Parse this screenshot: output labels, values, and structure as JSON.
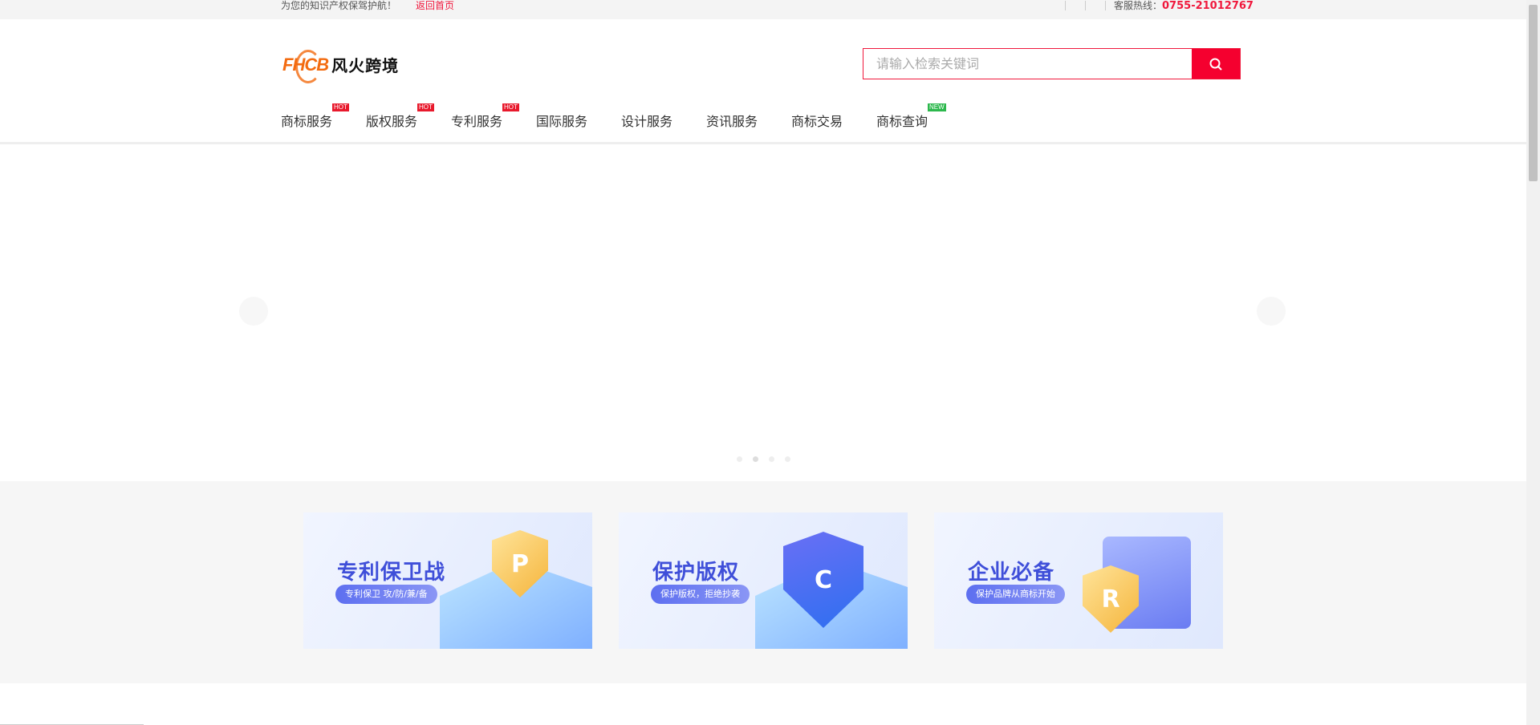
{
  "topbar": {
    "slogan": "为您的知识产权保驾护航！",
    "home_link": "返回首页",
    "hotline_label": "客服热线：",
    "hotline": "0755-21012767"
  },
  "header": {
    "logo_mark": "FHCB",
    "logo_text": "风火跨境",
    "search_placeholder": "请输入检索关键词"
  },
  "nav": [
    {
      "label": "商标服务",
      "badge": "HOT"
    },
    {
      "label": "版权服务",
      "badge": "HOT"
    },
    {
      "label": "专利服务",
      "badge": "HOT"
    },
    {
      "label": "国际服务"
    },
    {
      "label": "设计服务"
    },
    {
      "label": "资讯服务"
    },
    {
      "label": "商标交易"
    },
    {
      "label": "商标查询",
      "badge": "NEW"
    }
  ],
  "colors": {
    "accent": "#f5002f",
    "hot": "#e8192c",
    "new": "#2db84d"
  },
  "banner": {
    "dots": 4,
    "active_dot": 2
  },
  "promos": [
    {
      "title": "专利保卫战",
      "pill": "专利保卫 攻/防/兼/备",
      "icon": "P"
    },
    {
      "title": "保护版权",
      "pill": "保护版权，拒绝抄袭",
      "icon": "C"
    },
    {
      "title": "企业必备",
      "pill": "保护品牌从商标开始",
      "icon": "R"
    }
  ]
}
